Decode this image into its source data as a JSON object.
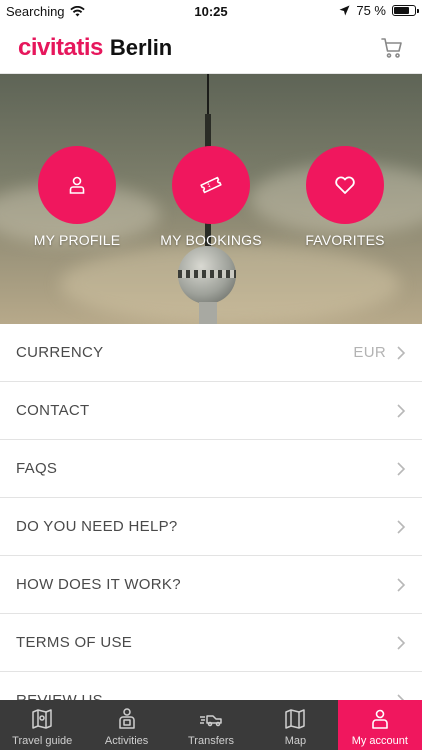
{
  "status_bar": {
    "carrier": "Searching",
    "time": "10:25",
    "battery": "75 %",
    "battery_level": 0.75
  },
  "header": {
    "brand": "civitatis",
    "city": "Berlin",
    "icons": {
      "cart": "cart-icon"
    }
  },
  "hero": {
    "actions": [
      {
        "label": "MY PROFILE",
        "icon": "profile-icon"
      },
      {
        "label": "MY BOOKINGS",
        "icon": "ticket-icon"
      },
      {
        "label": "FAVORITES",
        "icon": "heart-icon"
      }
    ]
  },
  "menu": {
    "items": [
      {
        "label": "CURRENCY",
        "value": "EUR"
      },
      {
        "label": "CONTACT"
      },
      {
        "label": "FAQS"
      },
      {
        "label": "DO YOU NEED HELP?"
      },
      {
        "label": "HOW DOES IT WORK?"
      },
      {
        "label": "TERMS OF USE"
      },
      {
        "label": "REVIEW US"
      }
    ]
  },
  "tab_bar": {
    "tabs": [
      {
        "label": "Travel guide",
        "icon": "map-book-icon",
        "active": false
      },
      {
        "label": "Activities",
        "icon": "guide-person-icon",
        "active": false
      },
      {
        "label": "Transfers",
        "icon": "transfer-car-icon",
        "active": false
      },
      {
        "label": "Map",
        "icon": "map-icon",
        "active": false
      },
      {
        "label": "My account",
        "icon": "account-icon",
        "active": true
      }
    ]
  },
  "colors": {
    "accent": "#f0175e",
    "brand": "#e6175c",
    "tab_bar_bg": "#3a3a3a"
  }
}
